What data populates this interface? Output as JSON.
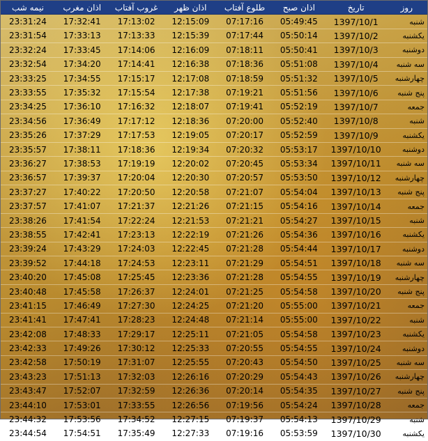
{
  "headers": [
    "روز",
    "تاریخ",
    "اذان صبح",
    "طلوع آفتاب",
    "اذان ظهر",
    "غروب آفتاب",
    "اذان مغرب",
    "نیمه شب"
  ],
  "rows": [
    [
      "شنبه",
      "1397/10/1",
      "05:49:45",
      "07:17:16",
      "12:15:09",
      "17:13:02",
      "17:32:41",
      "23:31:24"
    ],
    [
      "یکشنبه",
      "1397/10/2",
      "05:50:14",
      "07:17:44",
      "12:15:39",
      "17:13:33",
      "17:33:13",
      "23:31:54"
    ],
    [
      "دوشنبه",
      "1397/10/3",
      "05:50:41",
      "07:18:11",
      "12:16:09",
      "17:14:06",
      "17:33:45",
      "23:32:24"
    ],
    [
      "سه شنبه",
      "1397/10/4",
      "05:51:08",
      "07:18:36",
      "12:16:38",
      "17:14:41",
      "17:34:20",
      "23:32:54"
    ],
    [
      "چهارشنبه",
      "1397/10/5",
      "05:51:32",
      "07:18:59",
      "12:17:08",
      "17:15:17",
      "17:34:55",
      "23:33:25"
    ],
    [
      "پنج شنبه",
      "1397/10/6",
      "05:51:56",
      "07:19:21",
      "12:17:38",
      "17:15:54",
      "17:35:32",
      "23:33:55"
    ],
    [
      "جمعه",
      "1397/10/7",
      "05:52:19",
      "07:19:41",
      "12:18:07",
      "17:16:32",
      "17:36:10",
      "23:34:25"
    ],
    [
      "شنبه",
      "1397/10/8",
      "05:52:40",
      "07:20:00",
      "12:18:36",
      "17:17:12",
      "17:36:49",
      "23:34:56"
    ],
    [
      "یکشنبه",
      "1397/10/9",
      "05:52:59",
      "07:20:17",
      "12:19:05",
      "17:17:53",
      "17:37:29",
      "23:35:26"
    ],
    [
      "دوشنبه",
      "1397/10/10",
      "05:53:17",
      "07:20:32",
      "12:19:34",
      "17:18:36",
      "17:38:11",
      "23:35:57"
    ],
    [
      "سه شنبه",
      "1397/10/11",
      "05:53:34",
      "07:20:45",
      "12:20:02",
      "17:19:19",
      "17:38:53",
      "23:36:27"
    ],
    [
      "چهارشنبه",
      "1397/10/12",
      "05:53:50",
      "07:20:57",
      "12:20:30",
      "17:20:04",
      "17:39:37",
      "23:36:57"
    ],
    [
      "پنج شنبه",
      "1397/10/13",
      "05:54:04",
      "07:21:07",
      "12:20:58",
      "17:20:50",
      "17:40:22",
      "23:37:27"
    ],
    [
      "جمعه",
      "1397/10/14",
      "05:54:16",
      "07:21:15",
      "12:21:26",
      "17:21:37",
      "17:41:07",
      "23:37:57"
    ],
    [
      "شنبه",
      "1397/10/15",
      "05:54:27",
      "07:21:21",
      "12:21:53",
      "17:22:24",
      "17:41:54",
      "23:38:26"
    ],
    [
      "یکشنبه",
      "1397/10/16",
      "05:54:36",
      "07:21:26",
      "12:22:19",
      "17:23:13",
      "17:42:41",
      "23:38:55"
    ],
    [
      "دوشنبه",
      "1397/10/17",
      "05:54:44",
      "07:21:28",
      "12:22:45",
      "17:24:03",
      "17:43:29",
      "23:39:24"
    ],
    [
      "سه شنبه",
      "1397/10/18",
      "05:54:51",
      "07:21:29",
      "12:23:11",
      "17:24:53",
      "17:44:18",
      "23:39:52"
    ],
    [
      "چهارشنبه",
      "1397/10/19",
      "05:54:55",
      "07:21:28",
      "12:23:36",
      "17:25:45",
      "17:45:08",
      "23:40:20"
    ],
    [
      "پنج شنبه",
      "1397/10/20",
      "05:54:58",
      "07:21:25",
      "12:24:01",
      "17:26:37",
      "17:45:58",
      "23:40:48"
    ],
    [
      "جمعه",
      "1397/10/21",
      "05:55:00",
      "07:21:20",
      "12:24:25",
      "17:27:30",
      "17:46:49",
      "23:41:15"
    ],
    [
      "شنبه",
      "1397/10/22",
      "05:55:00",
      "07:21:14",
      "12:24:48",
      "17:28:23",
      "17:47:41",
      "23:41:41"
    ],
    [
      "یکشنبه",
      "1397/10/23",
      "05:54:58",
      "07:21:05",
      "12:25:11",
      "17:29:17",
      "17:48:33",
      "23:42:08"
    ],
    [
      "دوشنبه",
      "1397/10/24",
      "05:54:55",
      "07:20:55",
      "12:25:33",
      "17:30:12",
      "17:49:26",
      "23:42:33"
    ],
    [
      "سه شنبه",
      "1397/10/25",
      "05:54:50",
      "07:20:43",
      "12:25:55",
      "17:31:07",
      "17:50:19",
      "23:42:58"
    ],
    [
      "چهارشنبه",
      "1397/10/26",
      "05:54:43",
      "07:20:29",
      "12:26:16",
      "17:32:03",
      "17:51:13",
      "23:43:23"
    ],
    [
      "پنج شنبه",
      "1397/10/27",
      "05:54:35",
      "07:20:14",
      "12:26:36",
      "17:32:59",
      "17:52:07",
      "23:43:47"
    ],
    [
      "جمعه",
      "1397/10/28",
      "05:54:24",
      "07:19:56",
      "12:26:56",
      "17:33:55",
      "17:53:01",
      "23:44:10"
    ],
    [
      "شنبه",
      "1397/10/29",
      "05:54:13",
      "07:19:37",
      "12:27:15",
      "17:34:52",
      "17:53:56",
      "23:44:32"
    ],
    [
      "یکشنبه",
      "1397/10/30",
      "05:53:59",
      "07:19:16",
      "12:27:33",
      "17:35:49",
      "17:54:51",
      "23:44:54"
    ]
  ]
}
